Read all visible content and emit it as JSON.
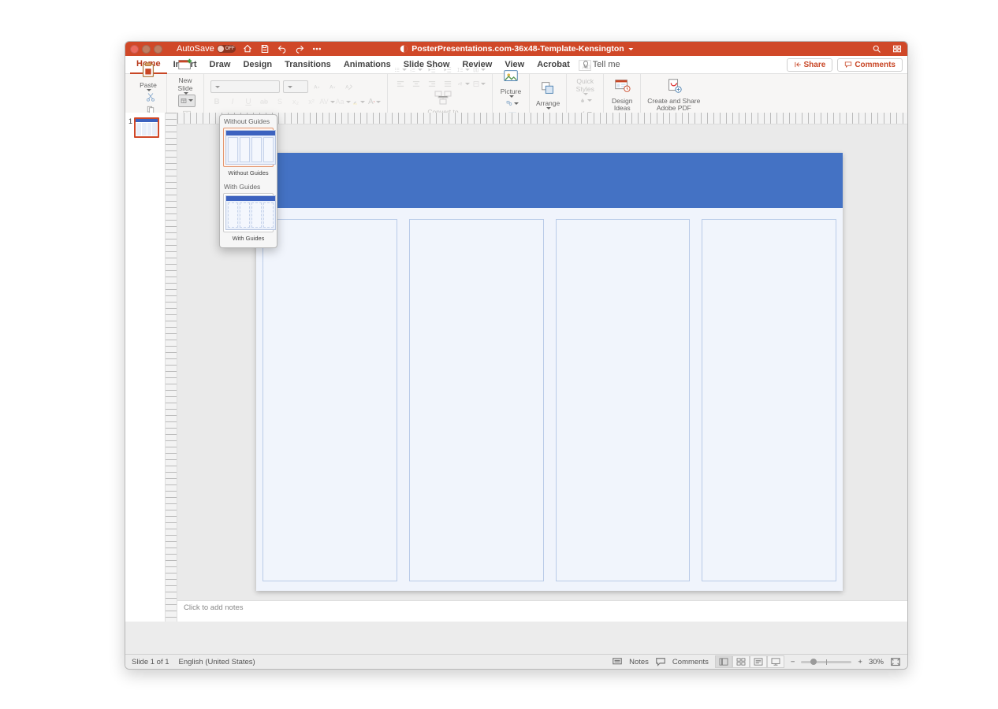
{
  "titlebar": {
    "autosave_label": "AutoSave",
    "autosave_state": "OFF",
    "doc_title": "PosterPresentations.com-36x48-Template-Kensington"
  },
  "menu": {
    "items": [
      "Home",
      "Insert",
      "Draw",
      "Design",
      "Transitions",
      "Animations",
      "Slide Show",
      "Review",
      "View",
      "Acrobat"
    ],
    "active": "Home",
    "tell_me": "Tell me",
    "share": "Share",
    "comments": "Comments"
  },
  "ribbon": {
    "paste": "Paste",
    "new_slide": "New\nSlide",
    "picture": "Picture",
    "arrange": "Arrange",
    "quick_styles": "Quick\nStyles",
    "design_ideas": "Design\nIdeas",
    "create_share_pdf": "Create and Share\nAdobe PDF",
    "convert_smartart": "Convert to\nSmartArt"
  },
  "layout_drop": {
    "without": "Without Guides",
    "without_cap": "Without Guides",
    "with": "With Guides",
    "with_cap": "With Guides"
  },
  "thumb": {
    "number": "1"
  },
  "notes": {
    "placeholder": "Click to add notes"
  },
  "status": {
    "slide": "Slide 1 of 1",
    "lang": "English (United States)",
    "notes": "Notes",
    "comments": "Comments",
    "zoom": "30%"
  }
}
